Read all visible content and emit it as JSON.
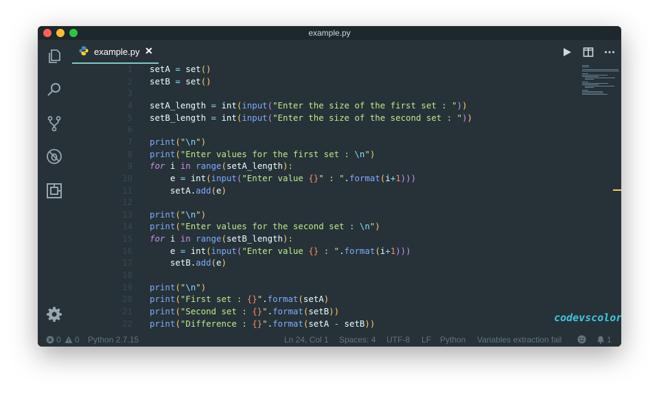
{
  "window": {
    "title": "example.py",
    "tab_label": "example.py",
    "tab_close_glyph": "✕"
  },
  "activity_icons": [
    "files-icon",
    "search-icon",
    "source-control-icon",
    "debug-icon",
    "extensions-icon",
    "gear-icon"
  ],
  "toolbar_icons": [
    "run-icon",
    "split-editor-icon",
    "more-icon"
  ],
  "editor": {
    "lines": [
      {
        "no": "1",
        "tokens": [
          [
            "setA ",
            "plain"
          ],
          [
            "=",
            "op"
          ],
          [
            " set",
            "plain"
          ],
          [
            "()",
            "paren"
          ]
        ]
      },
      {
        "no": "2",
        "tokens": [
          [
            "setB ",
            "plain"
          ],
          [
            "=",
            "op"
          ],
          [
            " set",
            "plain"
          ],
          [
            "()",
            "paren"
          ]
        ]
      },
      {
        "no": "3",
        "tokens": []
      },
      {
        "no": "4",
        "tokens": [
          [
            "setA_length ",
            "plain"
          ],
          [
            "=",
            "op"
          ],
          [
            " int",
            "plain"
          ],
          [
            "(",
            "paren"
          ],
          [
            "input",
            "func"
          ],
          [
            "(",
            "bracket"
          ],
          [
            "\"Enter the size of the first set : \"",
            "str"
          ],
          [
            ")",
            "bracket"
          ],
          [
            ")",
            "paren"
          ]
        ]
      },
      {
        "no": "5",
        "tokens": [
          [
            "setB_length ",
            "plain"
          ],
          [
            "=",
            "op"
          ],
          [
            " int",
            "plain"
          ],
          [
            "(",
            "paren"
          ],
          [
            "input",
            "func"
          ],
          [
            "(",
            "bracket"
          ],
          [
            "\"Enter the size of the second set : \"",
            "str"
          ],
          [
            ")",
            "bracket"
          ],
          [
            ")",
            "paren"
          ]
        ]
      },
      {
        "no": "6",
        "tokens": []
      },
      {
        "no": "7",
        "tokens": [
          [
            "print",
            "func"
          ],
          [
            "(",
            "paren"
          ],
          [
            "\"",
            "str"
          ],
          [
            "\\n",
            "esc"
          ],
          [
            "\"",
            "str"
          ],
          [
            ")",
            "paren"
          ]
        ]
      },
      {
        "no": "8",
        "tokens": [
          [
            "print",
            "func"
          ],
          [
            "(",
            "paren"
          ],
          [
            "\"Enter values for the first set : ",
            "str"
          ],
          [
            "\\n",
            "esc"
          ],
          [
            "\"",
            "str"
          ],
          [
            ")",
            "paren"
          ]
        ]
      },
      {
        "no": "9",
        "tokens": [
          [
            "for",
            "kw"
          ],
          [
            " i ",
            "plain"
          ],
          [
            "in",
            "kw2"
          ],
          [
            " ",
            "plain"
          ],
          [
            "range",
            "func"
          ],
          [
            "(",
            "paren"
          ],
          [
            "setA_length",
            "plain"
          ],
          [
            "):",
            "paren"
          ]
        ]
      },
      {
        "no": "10",
        "tokens": [
          [
            "    e ",
            "plain"
          ],
          [
            "=",
            "op"
          ],
          [
            " int",
            "plain"
          ],
          [
            "(",
            "paren"
          ],
          [
            "input",
            "func"
          ],
          [
            "(",
            "bracket"
          ],
          [
            "\"Enter value ",
            "str"
          ],
          [
            "{}",
            "brace"
          ],
          [
            "\"",
            "str"
          ],
          [
            " : \"",
            "str"
          ],
          [
            ".",
            "plain"
          ],
          [
            "format",
            "func"
          ],
          [
            "(",
            "paren"
          ],
          [
            "i",
            "plain"
          ],
          [
            "+",
            "op"
          ],
          [
            "1",
            "brace"
          ],
          [
            ")))",
            "bracket"
          ]
        ]
      },
      {
        "no": "11",
        "tokens": [
          [
            "    setA",
            "plain"
          ],
          [
            ".",
            "plain"
          ],
          [
            "add",
            "func"
          ],
          [
            "(",
            "paren"
          ],
          [
            "e",
            "plain"
          ],
          [
            ")",
            "paren"
          ]
        ]
      },
      {
        "no": "12",
        "tokens": []
      },
      {
        "no": "13",
        "tokens": [
          [
            "print",
            "func"
          ],
          [
            "(",
            "paren"
          ],
          [
            "\"",
            "str"
          ],
          [
            "\\n",
            "esc"
          ],
          [
            "\"",
            "str"
          ],
          [
            ")",
            "paren"
          ]
        ]
      },
      {
        "no": "14",
        "tokens": [
          [
            "print",
            "func"
          ],
          [
            "(",
            "paren"
          ],
          [
            "\"Enter values for the second set : ",
            "str"
          ],
          [
            "\\n",
            "esc"
          ],
          [
            "\"",
            "str"
          ],
          [
            ")",
            "paren"
          ]
        ]
      },
      {
        "no": "15",
        "tokens": [
          [
            "for",
            "kw"
          ],
          [
            " i ",
            "plain"
          ],
          [
            "in",
            "kw2"
          ],
          [
            " ",
            "plain"
          ],
          [
            "range",
            "func"
          ],
          [
            "(",
            "paren"
          ],
          [
            "setB_length",
            "plain"
          ],
          [
            "):",
            "paren"
          ]
        ]
      },
      {
        "no": "16",
        "tokens": [
          [
            "    e ",
            "plain"
          ],
          [
            "=",
            "op"
          ],
          [
            " int",
            "plain"
          ],
          [
            "(",
            "paren"
          ],
          [
            "input",
            "func"
          ],
          [
            "(",
            "bracket"
          ],
          [
            "\"Enter value ",
            "str"
          ],
          [
            "{}",
            "brace"
          ],
          [
            " : \"",
            "str"
          ],
          [
            ".",
            "plain"
          ],
          [
            "format",
            "func"
          ],
          [
            "(",
            "paren"
          ],
          [
            "i",
            "plain"
          ],
          [
            "+",
            "op"
          ],
          [
            "1",
            "brace"
          ],
          [
            ")))",
            "bracket"
          ]
        ]
      },
      {
        "no": "17",
        "tokens": [
          [
            "    setB",
            "plain"
          ],
          [
            ".",
            "plain"
          ],
          [
            "add",
            "func"
          ],
          [
            "(",
            "paren"
          ],
          [
            "e",
            "plain"
          ],
          [
            ")",
            "paren"
          ]
        ]
      },
      {
        "no": "18",
        "tokens": []
      },
      {
        "no": "19",
        "tokens": [
          [
            "print",
            "func"
          ],
          [
            "(",
            "paren"
          ],
          [
            "\"",
            "str"
          ],
          [
            "\\n",
            "esc"
          ],
          [
            "\"",
            "str"
          ],
          [
            ")",
            "paren"
          ]
        ]
      },
      {
        "no": "20",
        "tokens": [
          [
            "print",
            "func"
          ],
          [
            "(",
            "paren"
          ],
          [
            "\"First set : ",
            "str"
          ],
          [
            "{}",
            "brace"
          ],
          [
            "\"",
            "str"
          ],
          [
            ".",
            "plain"
          ],
          [
            "format",
            "func"
          ],
          [
            "(",
            "paren"
          ],
          [
            "setA",
            "plain"
          ],
          [
            ")",
            "paren"
          ]
        ]
      },
      {
        "no": "21",
        "tokens": [
          [
            "print",
            "func"
          ],
          [
            "(",
            "paren"
          ],
          [
            "\"Second set : ",
            "str"
          ],
          [
            "{}",
            "brace"
          ],
          [
            "\"",
            "str"
          ],
          [
            ".",
            "plain"
          ],
          [
            "format",
            "func"
          ],
          [
            "(",
            "paren"
          ],
          [
            "setB",
            "plain"
          ],
          [
            "))",
            "paren"
          ]
        ]
      },
      {
        "no": "22",
        "tokens": [
          [
            "print",
            "func"
          ],
          [
            "(",
            "paren"
          ],
          [
            "\"Difference : ",
            "str"
          ],
          [
            "{}",
            "brace"
          ],
          [
            "\"",
            "str"
          ],
          [
            ".",
            "plain"
          ],
          [
            "format",
            "func"
          ],
          [
            "(",
            "paren"
          ],
          [
            "setA ",
            "plain"
          ],
          [
            "-",
            "op"
          ],
          [
            " setB",
            "plain"
          ],
          [
            "))",
            "paren"
          ]
        ]
      }
    ]
  },
  "watermark": "codevscolor.com",
  "statusbar": {
    "errors": "0",
    "warnings": "0",
    "interpreter": "Python 2.7.15",
    "position": "Ln 24, Col 1",
    "spaces": "Spaces: 4",
    "encoding": "UTF-8",
    "eol": "LF",
    "language": "Python",
    "message": "Variables extraction fail",
    "notifications": "1"
  },
  "colors": {
    "background": "#263238",
    "accent": "#80cbc4",
    "string": "#c3e88d",
    "function": "#82aaff",
    "keyword": "#c792ea",
    "paren": "#ffcb6b",
    "operator": "#89ddff",
    "number": "#f78c6c"
  }
}
